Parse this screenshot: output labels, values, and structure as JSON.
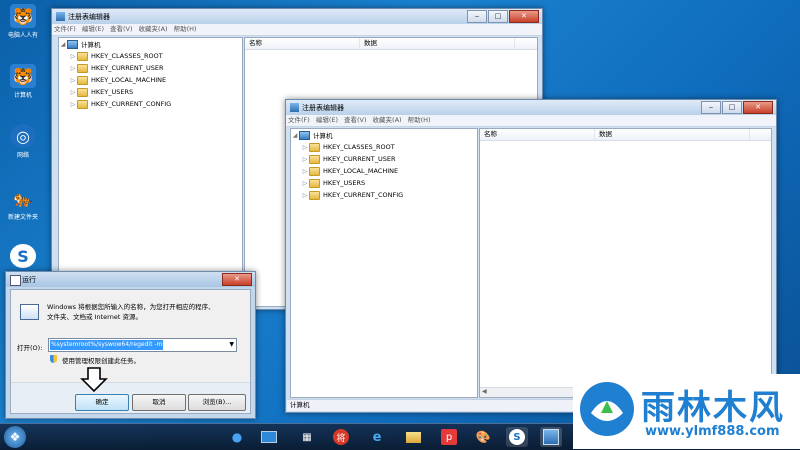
{
  "desktop": {
    "icons": [
      {
        "label": "电脑人人有"
      },
      {
        "label": "计算机"
      },
      {
        "label": "网络"
      },
      {
        "label": "新建文件夹"
      },
      {
        "label": ""
      }
    ]
  },
  "regedit_back": {
    "title": "注册表编辑器",
    "menu": [
      "文件(F)",
      "编辑(E)",
      "查看(V)",
      "收藏夹(A)",
      "帮助(H)"
    ],
    "tree_root": "计算机",
    "tree_items": [
      "HKEY_CLASSES_ROOT",
      "HKEY_CURRENT_USER",
      "HKEY_LOCAL_MACHINE",
      "HKEY_USERS",
      "HKEY_CURRENT_CONFIG"
    ],
    "col_name": "名称",
    "col_data": "数据"
  },
  "regedit_front": {
    "title": "注册表编辑器",
    "menu": [
      "文件(F)",
      "编辑(E)",
      "查看(V)",
      "收藏夹(A)",
      "帮助(H)"
    ],
    "tree_root": "计算机",
    "tree_items": [
      "HKEY_CLASSES_ROOT",
      "HKEY_CURRENT_USER",
      "HKEY_LOCAL_MACHINE",
      "HKEY_USERS",
      "HKEY_CURRENT_CONFIG"
    ],
    "col_name": "名称",
    "col_data": "数据",
    "status": "计算机"
  },
  "run_dialog": {
    "title": "运行",
    "desc_line1": "Windows 将根据您所输入的名称，为您打开相应的程序、",
    "desc_line2": "文件夹、文档或 Internet 资源。",
    "open_label": "打开(O):",
    "open_value": "%systemroot%/syswow64/regedit -m",
    "admin_note": "使用管理权限创建此任务。",
    "ok_label": "确定",
    "cancel_label": "取消",
    "browse_label": "浏览(B)..."
  },
  "watermark": {
    "brand": "雨林木风",
    "url": "www.ylmf888.com"
  },
  "colors": {
    "accent": "#1a6fc4",
    "selection": "#3399ff"
  }
}
